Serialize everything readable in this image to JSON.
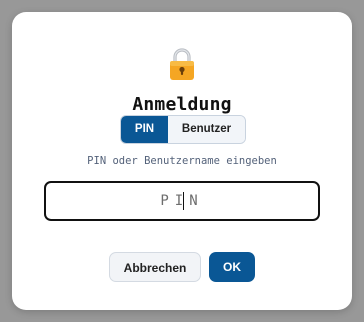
{
  "dialog": {
    "icon": "lock-icon",
    "title": "Anmeldung",
    "mode_tabs": [
      {
        "label": "PIN",
        "active": true
      },
      {
        "label": "Benutzer",
        "active": false
      }
    ],
    "hint": "PIN oder Benutzername eingeben",
    "input": {
      "placeholder": "PIN",
      "value": ""
    },
    "cancel_label": "Abbrechen",
    "ok_label": "OK"
  },
  "colors": {
    "accent": "#0a5795",
    "backdrop": "#989898",
    "dialog_bg": "#ffffff",
    "hint_text": "#54627a"
  }
}
